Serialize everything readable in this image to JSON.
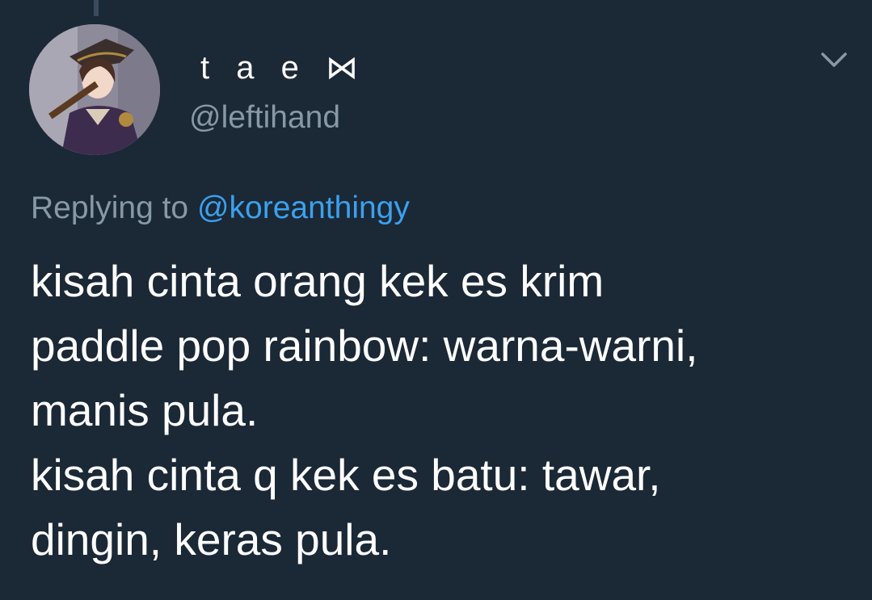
{
  "tweet": {
    "display_name": "t a e ⋈",
    "username": "@leftihand",
    "replying_prefix": "Replying to",
    "replying_to": "@koreanthingy",
    "text_lines": [
      "kisah cinta orang kek es krim",
      "paddle pop rainbow: warna-warni,",
      "manis pula.",
      "kisah cinta q kek es batu: tawar,",
      "dingin, keras pula."
    ]
  },
  "icons": {
    "avatar": "avatar-profile-photo",
    "menu": "chevron-down-icon"
  },
  "colors": {
    "background": "#1b2836",
    "primary_text": "#ffffff",
    "secondary_text": "#8899a6",
    "link": "#3ba1ee"
  }
}
